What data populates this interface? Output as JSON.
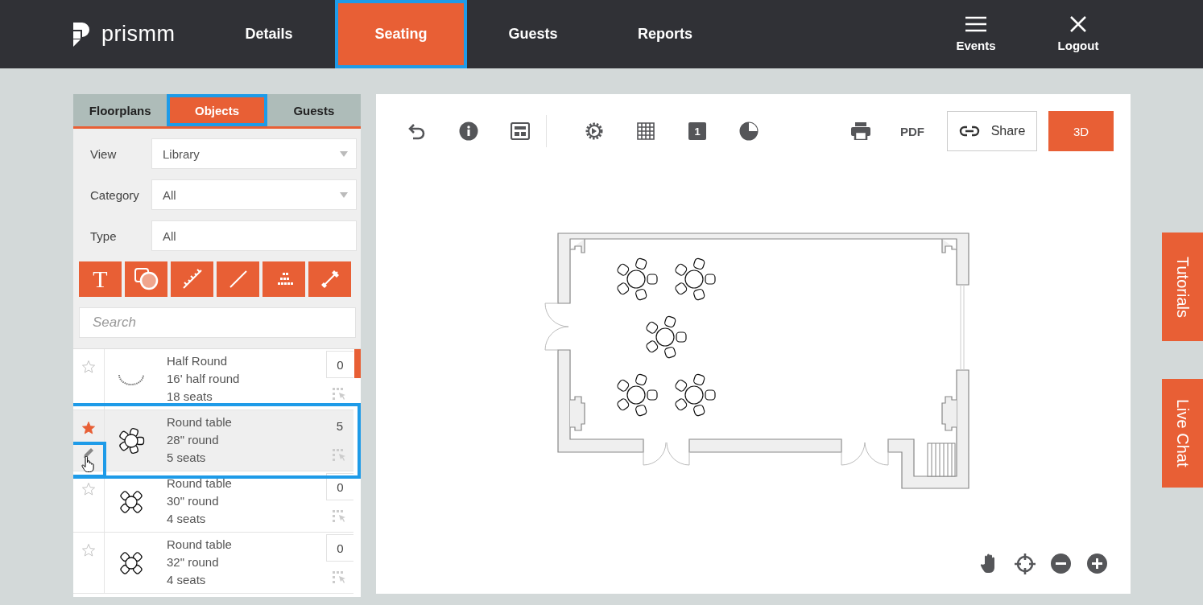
{
  "header": {
    "logo": "prismm",
    "tabs": [
      {
        "label": "Details",
        "selected": false,
        "highlighted": false
      },
      {
        "label": "Seating",
        "selected": true,
        "highlighted": true
      },
      {
        "label": "Guests",
        "selected": false,
        "highlighted": false
      },
      {
        "label": "Reports",
        "selected": false,
        "highlighted": false
      }
    ],
    "actions": [
      {
        "label": "Events",
        "kind": "menu"
      },
      {
        "label": "Logout",
        "kind": "close"
      }
    ]
  },
  "panel": {
    "tabs": [
      {
        "label": "Floorplans",
        "selected": false,
        "highlighted": false
      },
      {
        "label": "Objects",
        "selected": true,
        "highlighted": true
      },
      {
        "label": "Guests",
        "selected": false,
        "highlighted": false
      }
    ],
    "filters": [
      {
        "label": "View",
        "value": "Library",
        "kind": "select"
      },
      {
        "label": "Category",
        "value": "All",
        "kind": "select"
      },
      {
        "label": "Type",
        "value": "All",
        "kind": "text"
      }
    ],
    "tools": [
      {
        "kind": "text",
        "glyph": "T"
      },
      {
        "kind": "shapes"
      },
      {
        "kind": "ruler"
      },
      {
        "kind": "line"
      },
      {
        "kind": "dots"
      },
      {
        "kind": "measure"
      }
    ],
    "search": {
      "placeholder": "Search"
    },
    "objects": [
      {
        "name": "Half Round",
        "size": "16' half round",
        "seats": "18 seats",
        "count": "0",
        "starred": false,
        "selected": false,
        "highlighted": false,
        "kind": "half"
      },
      {
        "name": "Round table",
        "size": "28\" round",
        "seats": "5 seats",
        "count": "5",
        "starred": true,
        "selected": true,
        "highlighted": true,
        "kind": "five"
      },
      {
        "name": "Round table",
        "size": "30\" round",
        "seats": "4 seats",
        "count": "0",
        "starred": false,
        "selected": false,
        "highlighted": false,
        "kind": "four"
      },
      {
        "name": "Round table",
        "size": "32\" round",
        "seats": "4 seats",
        "count": "0",
        "starred": false,
        "selected": false,
        "highlighted": false,
        "kind": "four"
      }
    ]
  },
  "canvas": {
    "toolbar": {
      "layer_badge": "1",
      "pdf": "PDF",
      "share": "Share",
      "view_3d": "3D"
    }
  },
  "side_tabs": [
    "Tutorials",
    "Live Chat"
  ]
}
